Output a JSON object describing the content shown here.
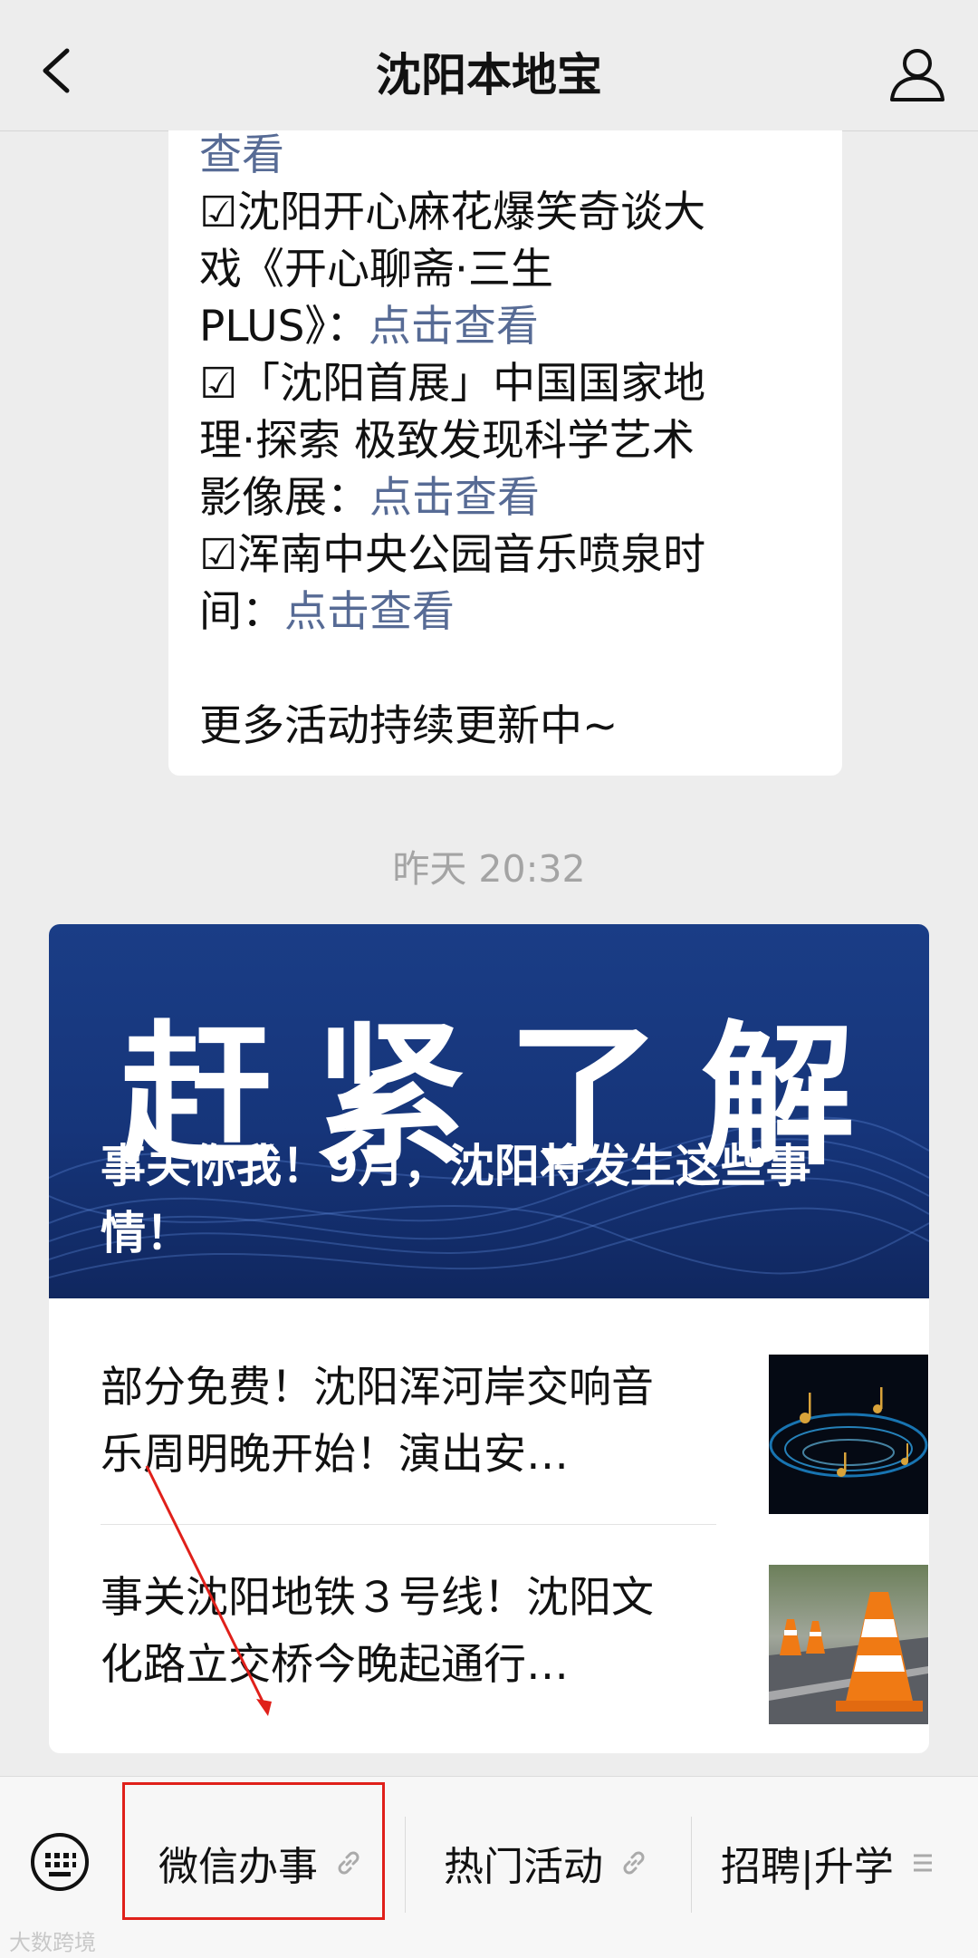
{
  "header": {
    "title": "沈阳本地宝",
    "back_icon": "chevron-left-icon",
    "profile_icon": "person-icon"
  },
  "message": {
    "lines": [
      {
        "text": "",
        "link": "查看"
      },
      {
        "text": "☑沈阳开心麻花爆笑奇谈大",
        "link": ""
      },
      {
        "text": "戏《开心聊斋·三生",
        "link": ""
      },
      {
        "text": "PLUS》：",
        "link": "点击查看"
      },
      {
        "text": "☑「沈阳首展」中国国家地",
        "link": ""
      },
      {
        "text": "理·探索 极致发现科学艺术",
        "link": ""
      },
      {
        "text": "影像展：",
        "link": "点击查看"
      },
      {
        "text": "☑浑南中央公园音乐喷泉时",
        "link": ""
      },
      {
        "text": "间：",
        "link": "点击查看"
      }
    ],
    "footer": "更多活动持续更新中~"
  },
  "timestamp": "昨天 20:32",
  "article": {
    "cover_big_text": "赶紧了解",
    "headline": "事关你我！9月，沈阳将发生这些事情！",
    "items": [
      {
        "title": "部分免费！沈阳浑河岸交响音乐周明晚开始！演出安…",
        "thumb": "music-notes-image"
      },
      {
        "title": "事关沈阳地铁３号线！沈阳文化路立交桥今晚起通行…",
        "thumb": "traffic-cone-image"
      }
    ]
  },
  "menu": {
    "keyboard_icon": "keyboard-icon",
    "items": [
      {
        "label": "微信办事",
        "icon": "link-icon"
      },
      {
        "label": "热门活动",
        "icon": "link-icon"
      },
      {
        "label": "招聘|升学",
        "icon": "menu-lines-icon"
      }
    ]
  },
  "watermark": "大数跨境",
  "colors": {
    "link": "#576b95",
    "highlight": "#e0201a",
    "cover": "#16357a"
  }
}
